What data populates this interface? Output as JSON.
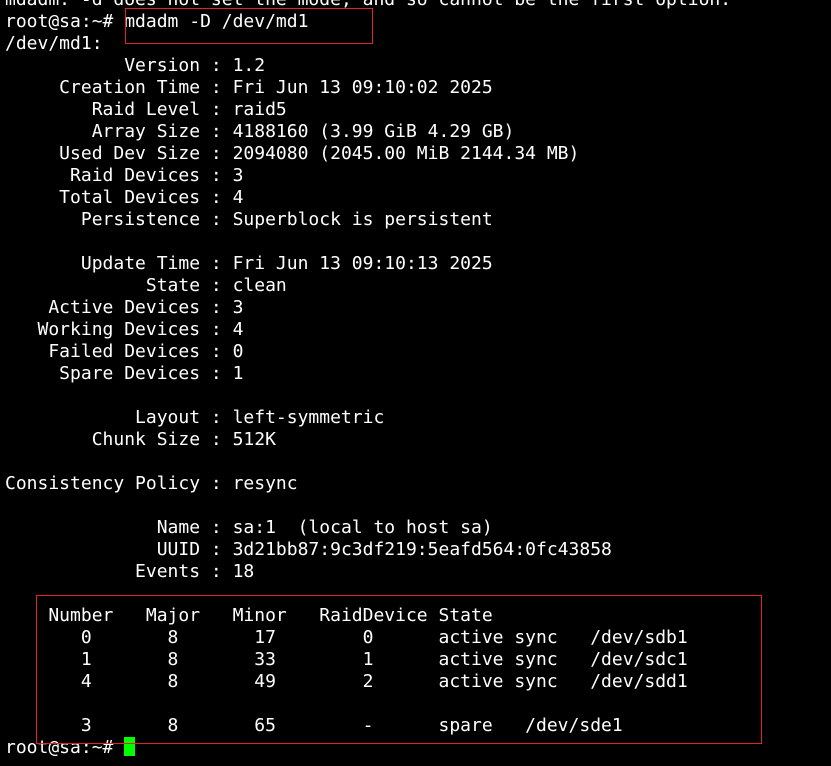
{
  "terminal": {
    "lines": [
      "mdadm: -d does not set the mode, and so cannot be the first option.",
      "root@sa:~# mdadm -D /dev/md1",
      "/dev/md1:",
      "           Version : 1.2",
      "     Creation Time : Fri Jun 13 09:10:02 2025",
      "        Raid Level : raid5",
      "        Array Size : 4188160 (3.99 GiB 4.29 GB)",
      "     Used Dev Size : 2094080 (2045.00 MiB 2144.34 MB)",
      "      Raid Devices : 3",
      "     Total Devices : 4",
      "       Persistence : Superblock is persistent",
      "",
      "       Update Time : Fri Jun 13 09:10:13 2025",
      "             State : clean",
      "    Active Devices : 3",
      "   Working Devices : 4",
      "    Failed Devices : 0",
      "     Spare Devices : 1",
      "",
      "            Layout : left-symmetric",
      "        Chunk Size : 512K",
      "",
      "Consistency Policy : resync",
      "",
      "              Name : sa:1  (local to host sa)",
      "              UUID : 3d21bb87:9c3df219:5eafd564:0fc43858",
      "            Events : 18",
      "",
      "    Number   Major   Minor   RaidDevice State",
      "       0       8       17        0      active sync   /dev/sdb1",
      "       1       8       33        1      active sync   /dev/sdc1",
      "       4       8       49        2      active sync   /dev/sdd1",
      "",
      "       3       8       65        -      spare   /dev/sde1"
    ],
    "prompt": "root@sa:~# "
  },
  "colors": {
    "background": "#000000",
    "text": "#ffffff",
    "cursor": "#00ff00",
    "highlight_border": "#e0242b"
  }
}
